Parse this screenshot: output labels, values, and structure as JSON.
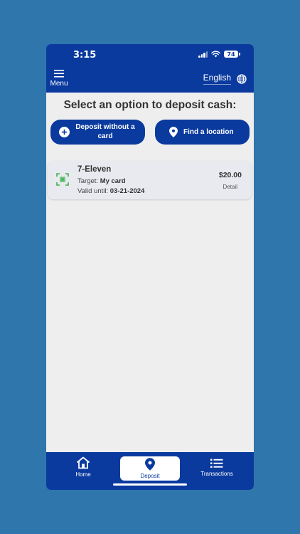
{
  "status_bar": {
    "time": "3:15",
    "battery": "74"
  },
  "header": {
    "menu_label": "Menu",
    "language": "English"
  },
  "main": {
    "title": "Select an option to deposit cash:",
    "deposit_button": "Deposit without a card",
    "find_button": "Find a location"
  },
  "card": {
    "name": "7-Eleven",
    "target_label": "Target: ",
    "target_value": "My card",
    "valid_label": "Valid until: ",
    "valid_value": "03-21-2024",
    "amount": "$20.00",
    "detail": "Detail"
  },
  "tabbar": {
    "home": "Home",
    "deposit": "Deposit",
    "transactions": "Transactions"
  },
  "colors": {
    "brand": "#0A3A9E",
    "background": "#2E76AC",
    "content": "#EEEEEE",
    "card_icon": "#3CB04A"
  },
  "icons": [
    "menu-icon",
    "globe-icon",
    "plus-circle-icon",
    "location-pin-icon",
    "barcode-scan-icon",
    "home-icon",
    "list-icon"
  ]
}
